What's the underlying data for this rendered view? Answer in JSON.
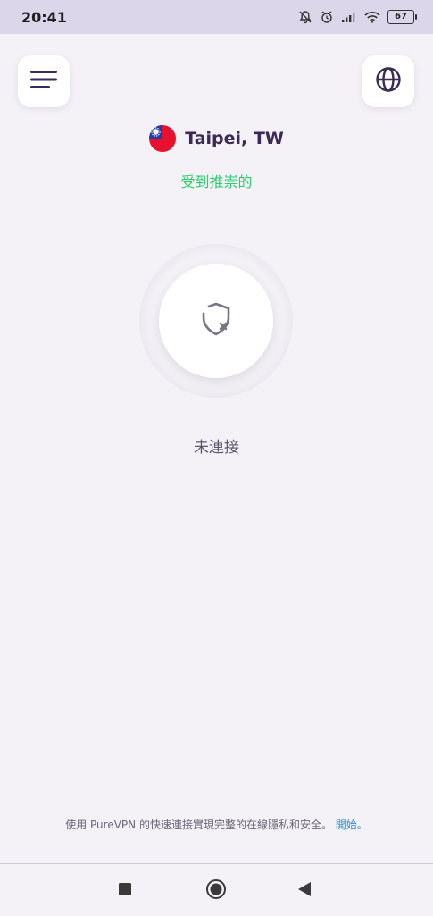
{
  "status_bar": {
    "time": "20:41",
    "battery": "67",
    "icons": [
      "mute-bell-icon",
      "alarm-icon",
      "signal-icon",
      "wifi-icon",
      "battery-icon"
    ]
  },
  "header": {
    "menu_icon": "hamburger-menu-icon",
    "globe_icon": "globe-icon"
  },
  "location": {
    "flag": "taiwan-flag-icon",
    "name": "Taipei, TW",
    "tag": "受到推崇的"
  },
  "connection": {
    "icon": "shield-x-icon",
    "status": "未連接"
  },
  "footer": {
    "text": "使用 PureVPN 的快速連接實現完整的在線隱私和安全。",
    "link": "開始。"
  },
  "colors": {
    "accent_green": "#2ecc71",
    "link_blue": "#2a8fd6",
    "brand_purple": "#3a2a55",
    "background": "#f4f2f7"
  }
}
